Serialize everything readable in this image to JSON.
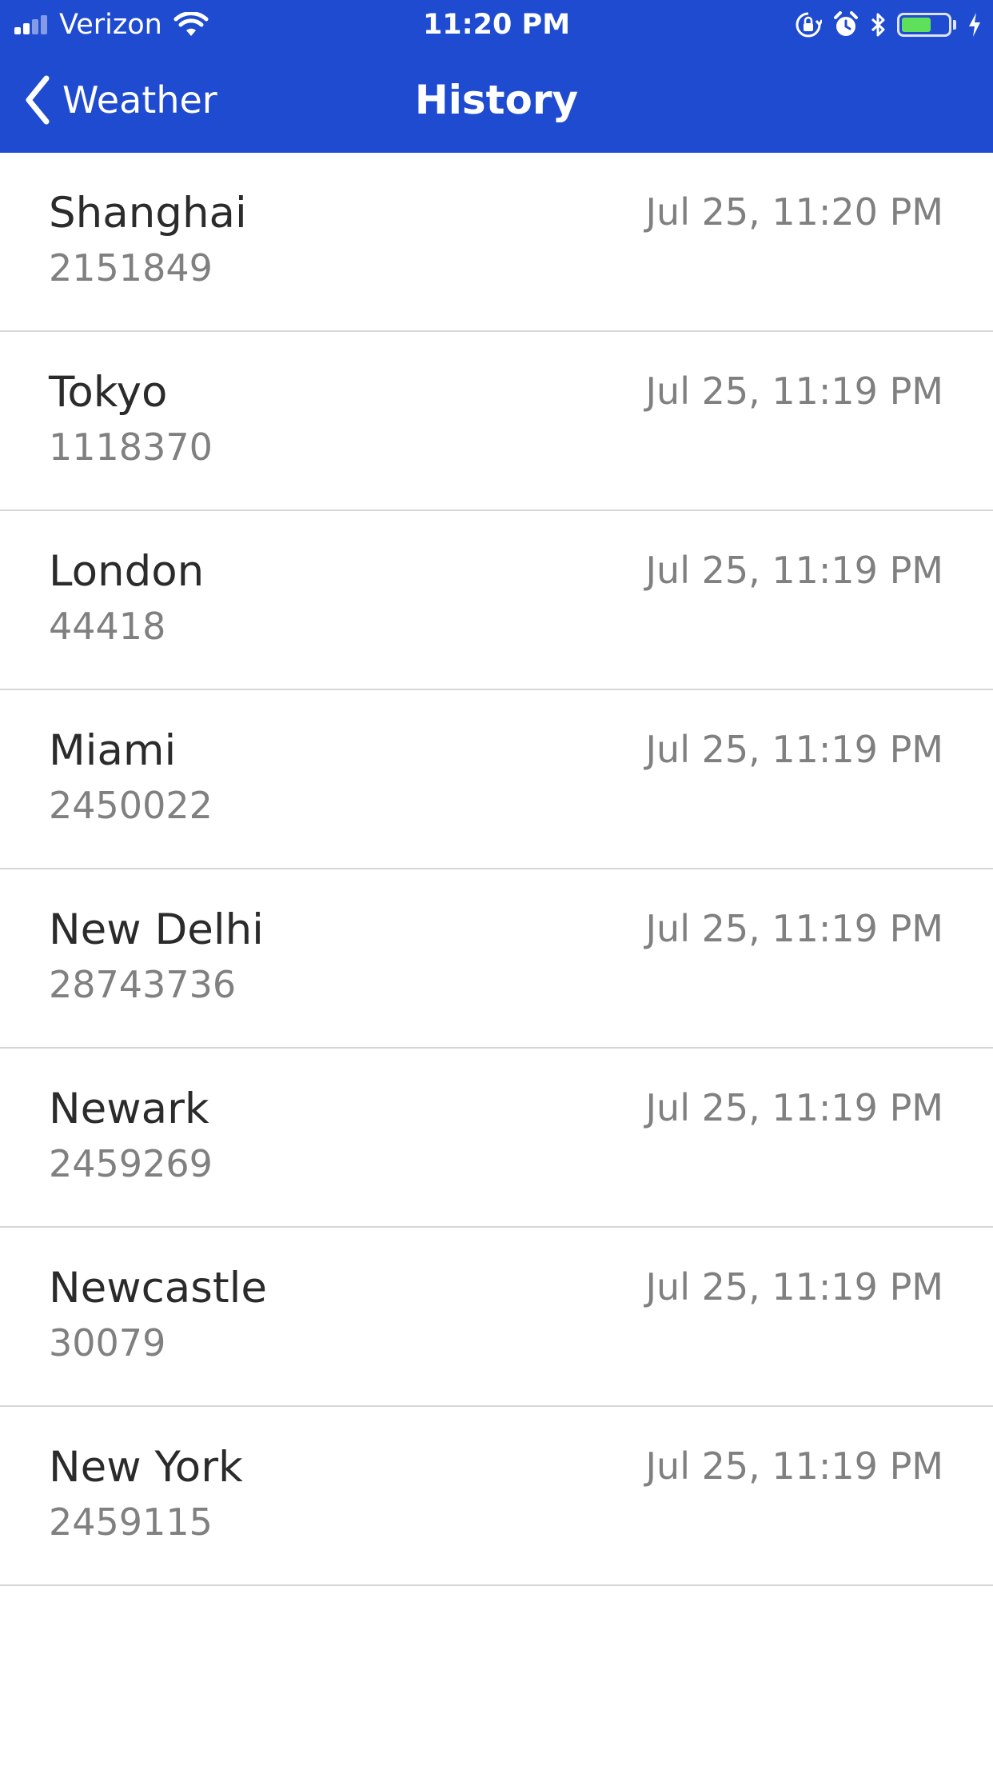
{
  "status_bar": {
    "carrier": "Verizon",
    "time": "11:20 PM",
    "battery_level": 0.65,
    "icons": [
      "signal-icon",
      "wifi-icon",
      "rotation-lock-icon",
      "alarm-icon",
      "bluetooth-icon",
      "battery-icon",
      "charging-icon"
    ]
  },
  "nav": {
    "back_label": "Weather",
    "title": "History"
  },
  "colors": {
    "header_bg": "#1f4bd1",
    "battery_fill": "#5fe05a",
    "primary_text": "#2b2b2b",
    "secondary_text": "#808080"
  },
  "history": [
    {
      "name": "Shanghai",
      "woeid": "2151849",
      "time": "Jul 25, 11:20 PM"
    },
    {
      "name": "Tokyo",
      "woeid": "1118370",
      "time": "Jul 25, 11:19 PM"
    },
    {
      "name": "London",
      "woeid": "44418",
      "time": "Jul 25, 11:19 PM"
    },
    {
      "name": "Miami",
      "woeid": "2450022",
      "time": "Jul 25, 11:19 PM"
    },
    {
      "name": "New Delhi",
      "woeid": "28743736",
      "time": "Jul 25, 11:19 PM"
    },
    {
      "name": "Newark",
      "woeid": "2459269",
      "time": "Jul 25, 11:19 PM"
    },
    {
      "name": "Newcastle",
      "woeid": "30079",
      "time": "Jul 25, 11:19 PM"
    },
    {
      "name": "New York",
      "woeid": "2459115",
      "time": "Jul 25, 11:19 PM"
    }
  ]
}
